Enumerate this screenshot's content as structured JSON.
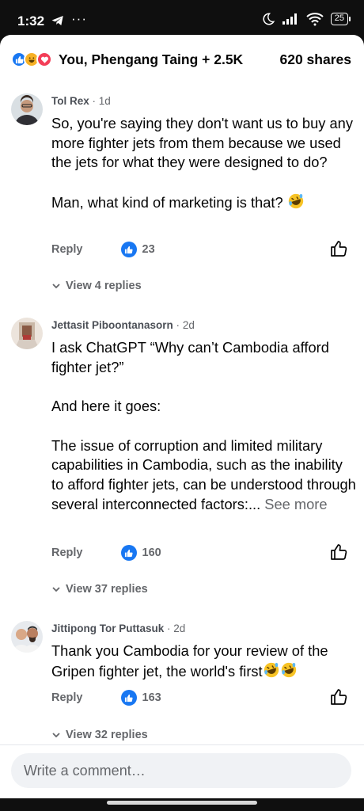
{
  "status_bar": {
    "time": "1:32",
    "dots": "···",
    "battery": "25"
  },
  "reactions": {
    "names": "You, Phengang Taing + 2.5K",
    "shares": "620 shares",
    "icons": [
      "like-icon",
      "haha-icon",
      "love-icon"
    ]
  },
  "comments": [
    {
      "author": "Tol Rex",
      "time": "1d",
      "text": "So, you're saying they don't want us to buy any more fighter jets from them because we used the jets for what they were designed to do?\n\nMan, what kind of marketing is that?",
      "emoji": "rolling-laughing-emoji",
      "reply_label": "Reply",
      "likes": "23",
      "view_replies": "View 4 replies"
    },
    {
      "author": "Jettasit Piboontanasorn",
      "time": "2d",
      "text": "I ask ChatGPT “Why can’t Cambodia afford fighter jet?”\n\nAnd here it goes:\n\nThe issue of corruption and limited military capabilities in Cambodia, such as the inability to afford fighter jets, can be understood through several interconnected factors:... ",
      "see_more": "See more",
      "reply_label": "Reply",
      "likes": "160",
      "view_replies": "View 37 replies"
    },
    {
      "author": "Jittipong Tor Puttasuk",
      "time": "2d",
      "text": "Thank you Cambodia for your review of the Gripen fighter jet, the world's first",
      "emoji": "rolling-laughing-emoji",
      "reply_label": "Reply",
      "likes": "163",
      "view_replies": "View 32 replies"
    }
  ],
  "composer": {
    "placeholder": "Write a comment…"
  },
  "colors": {
    "accent": "#1877f2",
    "text_primary": "#050505",
    "text_secondary": "#65676b",
    "input_bg": "#f0f2f5"
  }
}
